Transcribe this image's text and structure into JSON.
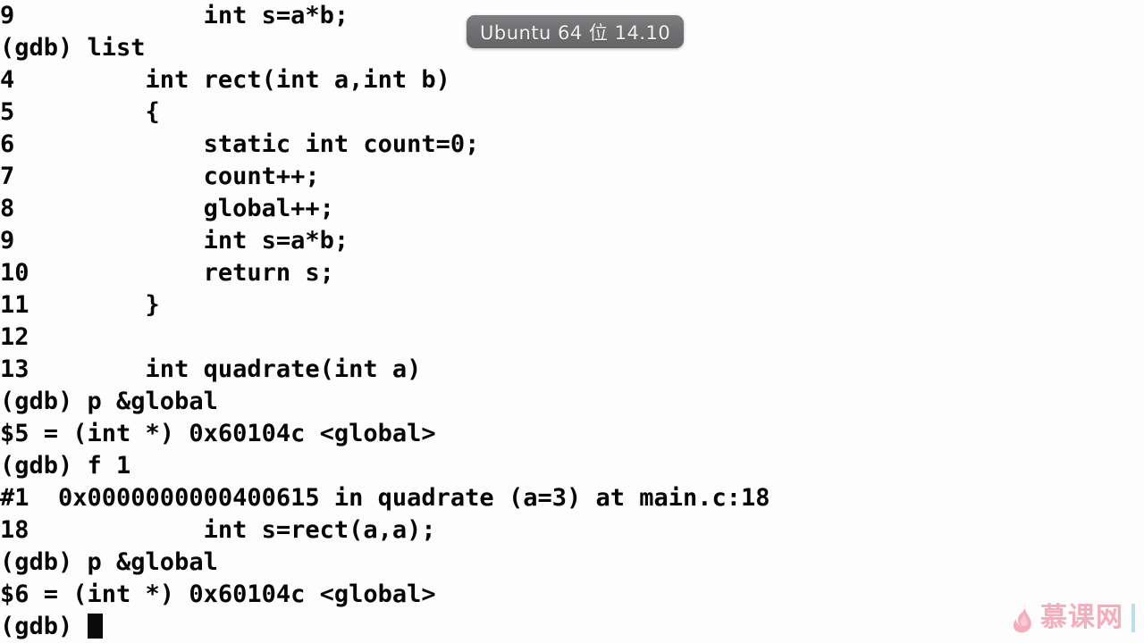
{
  "window": {
    "title": "gdb terminal session",
    "background_color": "#fdfdfd",
    "text_color": "#060606"
  },
  "badge": {
    "label": "Ubuntu 64 位 14.10",
    "background_color": "#6e6e70",
    "text_color": "#f2f2f2"
  },
  "terminal": {
    "prompt": "(gdb)",
    "cursor_visible": true,
    "lines": [
      "9\t        int s=a*b;",
      "(gdb) list",
      "4\t    int rect(int a,int b)",
      "5\t    {",
      "6\t        static int count=0;",
      "7\t        count++;",
      "8\t        global++;",
      "9\t        int s=a*b;",
      "10\t        return s;",
      "11\t    }",
      "12\t",
      "13\t    int quadrate(int a)",
      "(gdb) p &global",
      "$5 = (int *) 0x60104c <global>",
      "(gdb) f 1",
      "#1  0x0000000000400615 in quadrate (a=3) at main.c:18",
      "18\t        int s=rect(a,a);",
      "(gdb) p &global",
      "$6 = (int *) 0x60104c <global>",
      "(gdb) "
    ],
    "rendered_lines": [
      "9             int s=a*b;",
      "(gdb) list",
      "4         int rect(int a,int b)",
      "5         {",
      "6             static int count=0;",
      "7             count++;",
      "8             global++;",
      "9             int s=a*b;",
      "10            return s;",
      "11        }",
      "12",
      "13        int quadrate(int a)",
      "(gdb) p &global",
      "$5 = (int *) 0x60104c <global>",
      "(gdb) f 1",
      "#1  0x0000000000400615 in quadrate (a=3) at main.c:18",
      "18            int s=rect(a,a);",
      "(gdb) p &global",
      "$6 = (int *) 0x60104c <global>",
      "(gdb) "
    ],
    "commands_issued": [
      "list",
      "p &global",
      "f 1",
      "p &global"
    ],
    "values": {
      "dollar5": "$5 = (int *) 0x60104c <global>",
      "dollar6": "$6 = (int *) 0x60104c <global>",
      "frame1": "#1  0x0000000000400615 in quadrate (a=3) at main.c:18",
      "global_address": "0x60104c",
      "frame_pc": "0x0000000000400615",
      "frame_function": "quadrate",
      "frame_arg": "a=3",
      "frame_location": "main.c:18"
    }
  },
  "watermark": {
    "text": "慕课网",
    "logo_color": "#f08fa3",
    "text_color": "#f08fa3",
    "accent_color": "#9fd4e8"
  }
}
